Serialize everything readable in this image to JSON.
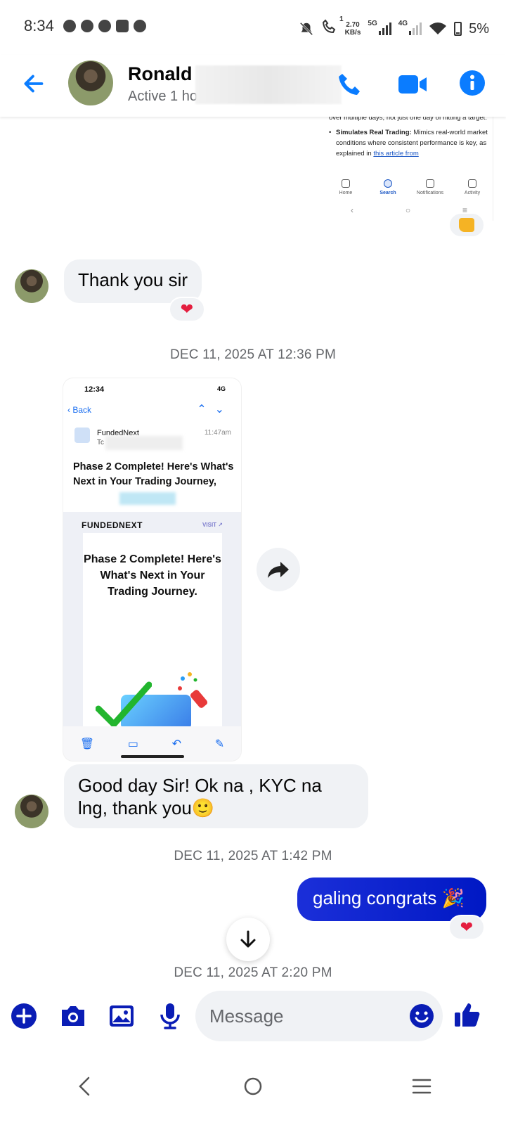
{
  "status_bar": {
    "time": "8:34",
    "net_speed_value": "2.70",
    "net_speed_unit": "KB/s",
    "net_type_1": "5G",
    "net_type_2": "4G",
    "call_sim": "1",
    "battery": "5%",
    "left_icons": [
      "messenger-icon",
      "whatsapp-icon",
      "chat-icon",
      "app-icon",
      "facebook-icon"
    ]
  },
  "header": {
    "name": "Ronald I",
    "status": "Active 1 ho",
    "accent": "#0a7cff"
  },
  "shared_shot": {
    "line1": "over multiple days, not just one day of hitting a target.",
    "bullet_bold": "Simulates Real Trading:",
    "bullet_text": " Mimics real-world market conditions where consistent performance is key, as explained in ",
    "bullet_link": "this article from",
    "nav": [
      "Home",
      "Search",
      "Notifications",
      "Activity"
    ]
  },
  "messages": [
    {
      "direction": "in",
      "text": "Thank you sir",
      "reaction": "heart"
    },
    {
      "timestamp": "DEC 11, 2025 AT 12:36 PM"
    },
    {
      "direction": "in",
      "text": "Good day Sir! Ok na , KYC na lng, thank you🙂"
    },
    {
      "timestamp": "DEC 11, 2025 AT 1:42 PM"
    },
    {
      "direction": "out",
      "text": "galing congrats 🎉",
      "reaction": "heart"
    },
    {
      "timestamp": "DEC 11, 2025 AT 2:20 PM"
    }
  ],
  "email_shot": {
    "time": "12:34",
    "signal": "4G",
    "back": "Back",
    "sender": "FundedNext",
    "to": "Tc",
    "received": "11:47am",
    "subject": "Phase 2 Complete! Here's What's Next in Your Trading Journey,",
    "brand": "FUNDEDNEXT",
    "visit": "VISIT",
    "card_title": "Phase 2 Complete! Here's What's Next in Your Trading Journey."
  },
  "composer": {
    "placeholder": "Message",
    "accent": "#0a1db5"
  }
}
